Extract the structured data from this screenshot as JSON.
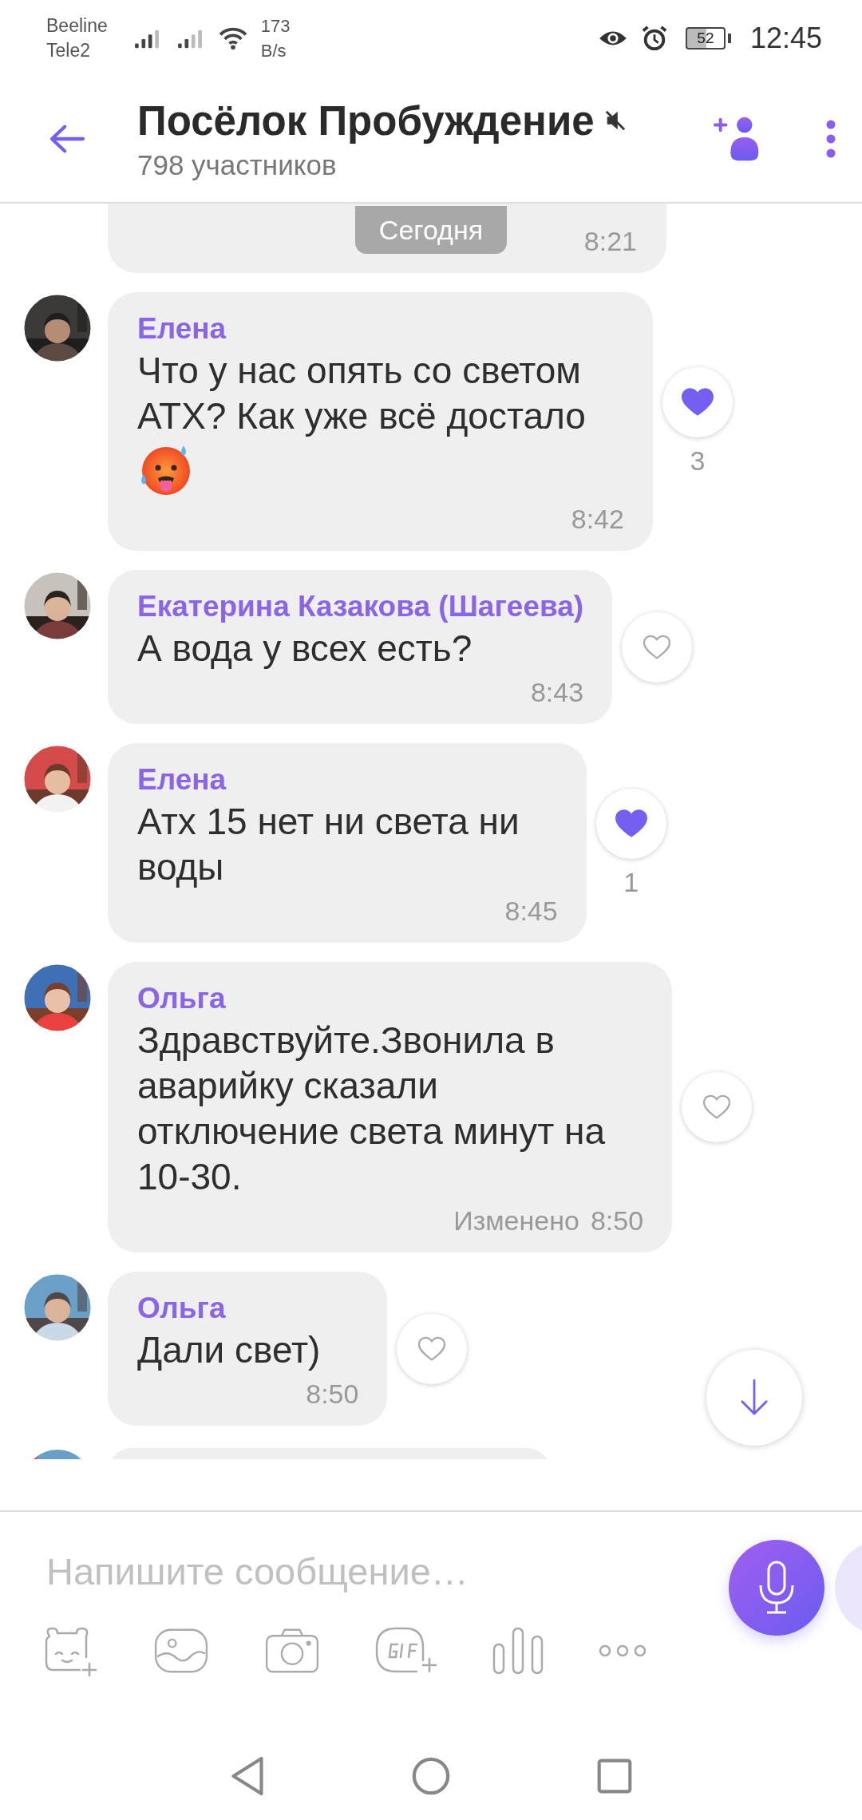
{
  "status_bar": {
    "carriers": [
      "Beeline",
      "Tele2"
    ],
    "speed": [
      "173",
      "B/s"
    ],
    "battery": "52",
    "time": "12:45"
  },
  "header": {
    "title": "Посёлок Пробуждение",
    "muted": true,
    "subtitle": "798 участников"
  },
  "date_chip": "Сегодня",
  "messages": [
    {
      "kind": "cut_top",
      "time": "8:21"
    },
    {
      "kind": "message",
      "sender": "Елена",
      "text": "Что у нас опять со светом\nАТХ? Как уже всё достало",
      "emoji": true,
      "time": "8:42",
      "reaction": {
        "liked": true,
        "count": "3"
      }
    },
    {
      "kind": "message",
      "sender": "Екатерина Казакова (Шагеева)",
      "text": "А вода у всех есть?",
      "time": "8:43",
      "reaction": {
        "liked": false
      }
    },
    {
      "kind": "message",
      "sender": "Елена",
      "text": "Атх 15 нет ни света ни\nводы",
      "time": "8:45",
      "reaction": {
        "liked": true,
        "count": "1"
      }
    },
    {
      "kind": "message",
      "sender": "Ольга",
      "text": "Здравствуйте.Звонила в\nаварийку сказали\nотключение света минут на\n10-30.",
      "edited": "Изменено",
      "time": "8:50",
      "reaction": {
        "liked": false
      }
    },
    {
      "kind": "message",
      "sender": "Ольга",
      "text": "Дали свет)",
      "time": "8:50",
      "reaction": {
        "liked": false
      }
    },
    {
      "kind": "cut_bottom"
    }
  ],
  "composer": {
    "placeholder": "Напишите сообщение…"
  }
}
